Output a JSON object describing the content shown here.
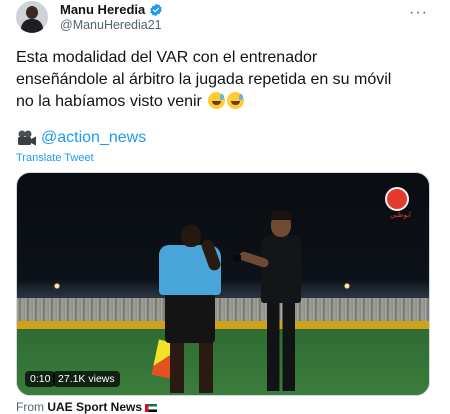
{
  "author": {
    "display_name": "Manu Heredia",
    "handle": "@ManuHeredia21",
    "verified": true,
    "avatar_icon": "profile-avatar"
  },
  "menu": {
    "more_label": "···"
  },
  "tweet": {
    "text_line1": "Esta modalidad del VAR con el entrenador",
    "text_line2": "enseñándole al árbitro la jugada repetida en su móvil",
    "text_line3": "no la habíamos visto venir",
    "emojis": [
      "grinning-sweat-emoji",
      "grinning-sweat-emoji"
    ],
    "link_icon": "movie-camera-icon",
    "mention": "@action_news",
    "translate_label": "Translate Tweet"
  },
  "media": {
    "duration": "0:10",
    "views": "27.1K views",
    "channel_logo_text": "ابوظبي"
  },
  "footer": {
    "prefix": "From",
    "source": "UAE Sport News",
    "flag_icon": "uae-flag-icon"
  },
  "colors": {
    "link": "#1d9bf0",
    "secondary_text": "#536471",
    "verified": "#1d9bf0"
  }
}
